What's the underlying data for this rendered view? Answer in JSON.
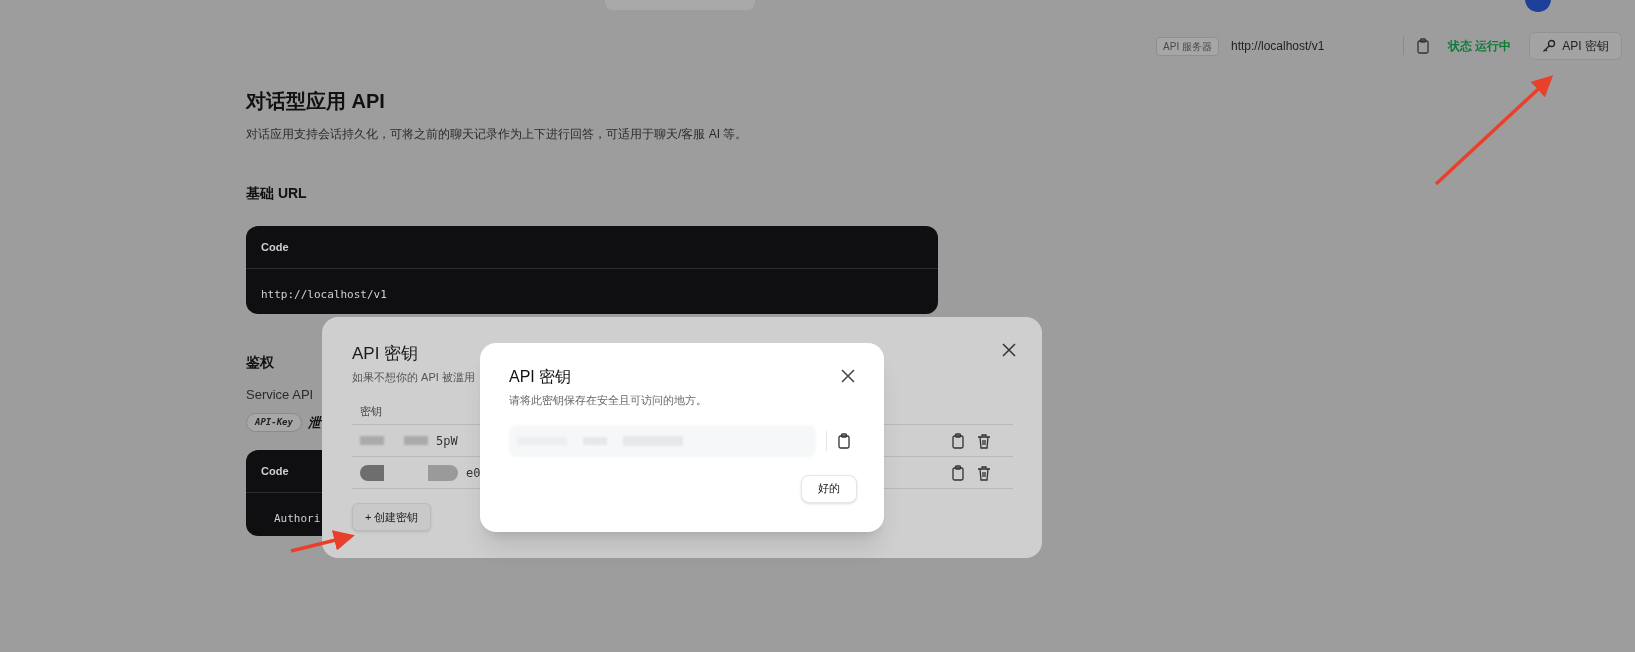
{
  "server": {
    "badge": "API 服务器",
    "url": "http://localhost/v1",
    "status": "状态 运行中",
    "key_button": "API 密钥"
  },
  "doc": {
    "title": "对话型应用 API",
    "description": "对话应用支持会话持久化，可将之前的聊天记录作为上下进行回答，可适用于聊天/客服 AI 等。",
    "base_url_heading": "基础 URL",
    "base_code": {
      "header": "Code",
      "code": "http://localhost/v1"
    },
    "auth_heading": "鉴权",
    "auth_text": "Service API",
    "auth_badge": "API-Key",
    "auth_warning": "泄",
    "auth_code": {
      "header": "Code",
      "code": "Authori"
    }
  },
  "keys_dialog": {
    "title": "API 密钥",
    "subtitle": "如果不想你的 API 被滥用",
    "column": "密钥",
    "rows": [
      {
        "key": "5pW"
      },
      {
        "key": "e0"
      }
    ],
    "create_button": "+ 创建密钥"
  },
  "new_key_dialog": {
    "title": "API 密钥",
    "message": "请将此密钥保存在安全且可访问的地方。",
    "ok_button": "好的"
  }
}
